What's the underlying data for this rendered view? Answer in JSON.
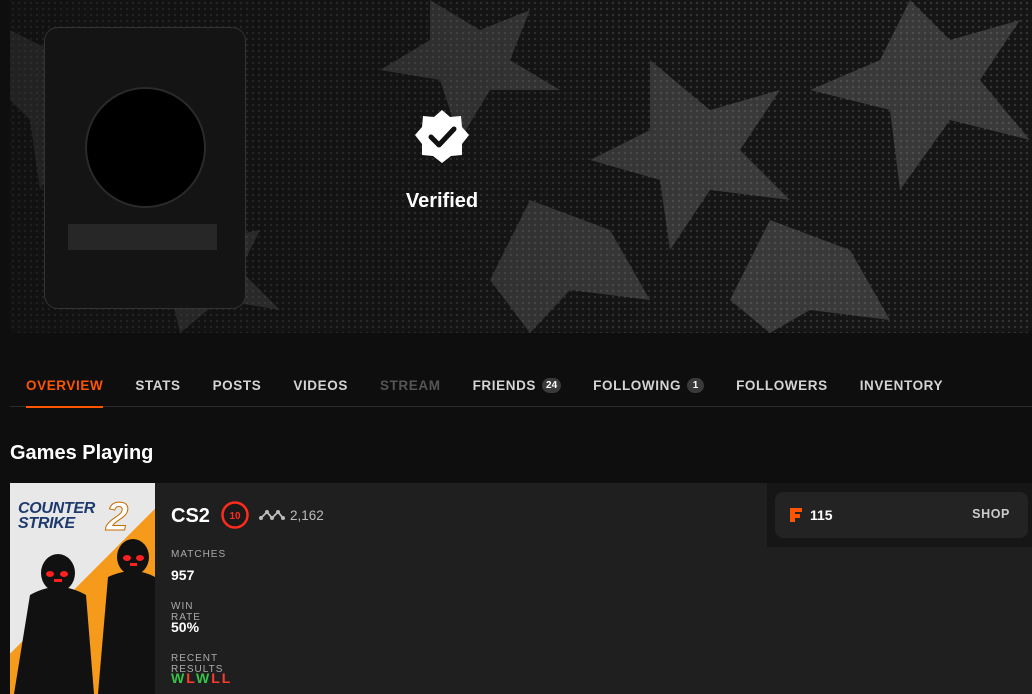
{
  "profile": {
    "verified_label": "Verified"
  },
  "tabs": [
    {
      "label": "OVERVIEW",
      "state": "active"
    },
    {
      "label": "STATS",
      "state": "normal"
    },
    {
      "label": "POSTS",
      "state": "normal"
    },
    {
      "label": "VIDEOS",
      "state": "normal"
    },
    {
      "label": "STREAM",
      "state": "disabled"
    },
    {
      "label": "FRIENDS",
      "state": "normal",
      "count": "24"
    },
    {
      "label": "FOLLOWING",
      "state": "normal",
      "count": "1"
    },
    {
      "label": "FOLLOWERS",
      "state": "normal"
    },
    {
      "label": "INVENTORY",
      "state": "normal"
    }
  ],
  "section": {
    "title": "Games Playing"
  },
  "game": {
    "art_title_line1": "COUNTER",
    "art_title_line2": "STRIKE",
    "art_title_number": "2",
    "name": "CS2",
    "level": "10",
    "elo": "2,162",
    "matches_label": "MATCHES",
    "matches_value": "957",
    "win_rate_label": "WIN RATE",
    "win_rate_value": "50%",
    "recent_results_label": "RECENT RESULTS",
    "recent_results": [
      "W",
      "L",
      "W",
      "L",
      "L"
    ]
  },
  "shop": {
    "points_icon_letter": "F",
    "points": "115",
    "button_label": "SHOP"
  },
  "colors": {
    "accent": "#ff5500",
    "win": "#35c24a",
    "loss": "#ff3b2f",
    "background": "#0e0e0e"
  },
  "icons": {
    "verified": "verified-badge-icon",
    "level": "skill-level-icon",
    "elo": "elo-graph-icon",
    "points": "faceit-points-icon"
  }
}
